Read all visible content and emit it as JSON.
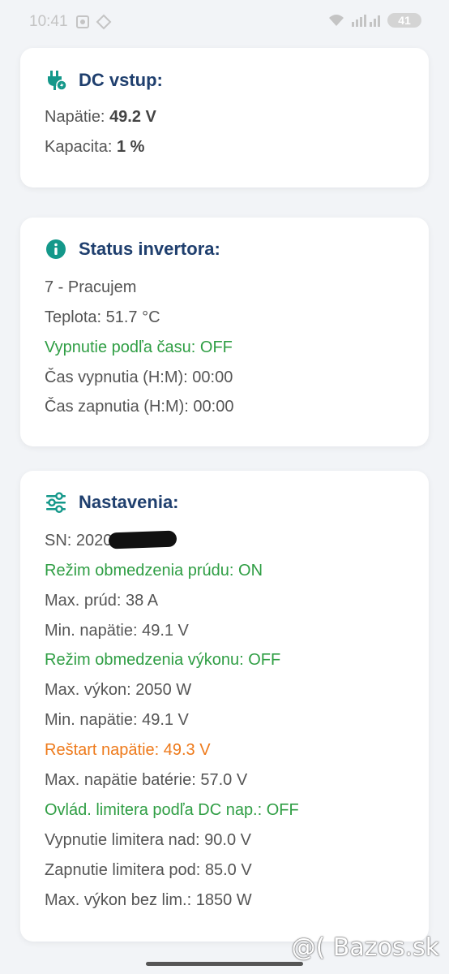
{
  "status_bar": {
    "time": "10:41",
    "battery": "41"
  },
  "dc_input": {
    "title": "DC vstup:",
    "voltage_label": "Napätie: ",
    "voltage_value": "49.2 V",
    "capacity_label": "Kapacita: ",
    "capacity_value": "1 %"
  },
  "inverter_status": {
    "title": "Status invertora:",
    "lines": [
      "7 - Pracujem",
      "Teplota: 51.7 °C",
      "Vypnutie podľa času: OFF",
      "Čas vypnutia (H:M): 00:00",
      "Čas zapnutia (H:M): 00:00"
    ]
  },
  "settings": {
    "title": "Nastavenia:",
    "sn_label": "SN: 2020",
    "lines": [
      "Režim obmedzenia prúdu: ON",
      "Max. prúd: 38 A",
      "Min. napätie: 49.1 V",
      "Režim obmedzenia výkonu: OFF",
      "Max. výkon: 2050 W",
      "Min. napätie: 49.1 V",
      "Reštart napätie: 49.3 V",
      "Max. napätie batérie: 57.0 V",
      "Ovlád. limitera podľa DC nap.: OFF",
      "Vypnutie limitera nad: 90.0 V",
      "Zapnutie limitera pod: 85.0 V",
      "Max. výkon bez lim.: 1850 W"
    ]
  },
  "watermark": "@( Bazos.sk",
  "colors": {
    "title": "#1f3f6e",
    "icon_teal": "#14988a",
    "green": "#2f9e44",
    "orange": "#ee7a1b"
  }
}
